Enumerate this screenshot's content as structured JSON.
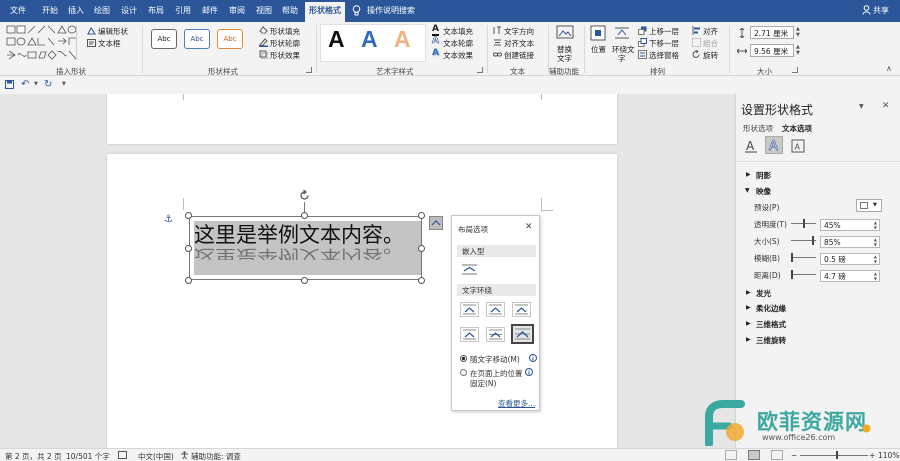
{
  "tabs": [
    "文件",
    "开始",
    "插入",
    "绘图",
    "设计",
    "布局",
    "引用",
    "邮件",
    "审阅",
    "视图",
    "帮助",
    "形状格式"
  ],
  "active_tab": "形状格式",
  "search_hint": "操作说明搜索",
  "share": "共享",
  "ribbon": {
    "insert_shapes": {
      "label": "插入形状",
      "edit_shape": "编辑形状",
      "text_box": "文本框"
    },
    "shape_styles": {
      "label": "形状样式",
      "preset": "Abc",
      "fill": "形状填充",
      "outline": "形状轮廓",
      "effects": "形状效果"
    },
    "wordart_styles": {
      "label": "艺术字样式",
      "sample": "A",
      "text_fill": "文本填充",
      "text_outline": "文本轮廓",
      "text_effects": "文本效果"
    },
    "text": {
      "label": "文本",
      "direction": "文字方向",
      "align": "对齐文本",
      "link": "创建链接"
    },
    "accessibility": {
      "label": "辅助功能",
      "alt_text_line1": "替换",
      "alt_text_line2": "文字"
    },
    "arrange": {
      "label": "排列",
      "position": "位置",
      "wrap_line1": "环绕文",
      "wrap_line2": "字",
      "bring_forward": "上移一层",
      "send_backward": "下移一层",
      "selection_pane": "选择窗格",
      "align": "对齐",
      "group": "组合",
      "rotate": "旋转"
    },
    "size": {
      "label": "大小",
      "height": "2.71 厘米",
      "width": "9.56 厘米"
    }
  },
  "document": {
    "textbox_text": "这里是举例文本内容。",
    "layout_options": {
      "title": "布局选项",
      "inline_label": "嵌入型",
      "wrap_label": "文字环绕",
      "move_with_text": "随文字移动(M)",
      "fix_position_line1": "在页面上的位置",
      "fix_position_line2": "固定(N)",
      "see_more": "查看更多..."
    }
  },
  "pane": {
    "title": "设置形状格式",
    "tab_shape": "形状选项",
    "tab_text": "文本选项",
    "sections": {
      "shadow": "阴影",
      "reflection": "映像",
      "glow": "发光",
      "soft_edges": "柔化边缘",
      "format_3d": "三维格式",
      "rotation_3d": "三维旋转"
    },
    "reflection": {
      "preset_label": "预设(P)",
      "transparency_label": "透明度(T)",
      "transparency_value": "45%",
      "size_label": "大小(S)",
      "size_value": "85%",
      "blur_label": "模糊(B)",
      "blur_value": "0.5 磅",
      "distance_label": "距离(D)",
      "distance_value": "4.7 磅"
    }
  },
  "status": {
    "page": "第 2 页，共 2 页",
    "words": "10/501 个字",
    "language": "中文(中国)",
    "accessibility": "辅助功能: 调查",
    "zoom": "110%"
  },
  "watermark": {
    "brand": "欧菲资源网",
    "url": "www.office26.com"
  },
  "colors": {
    "brand": "#2b579a",
    "watermark_teal": "#3ca9a0"
  }
}
